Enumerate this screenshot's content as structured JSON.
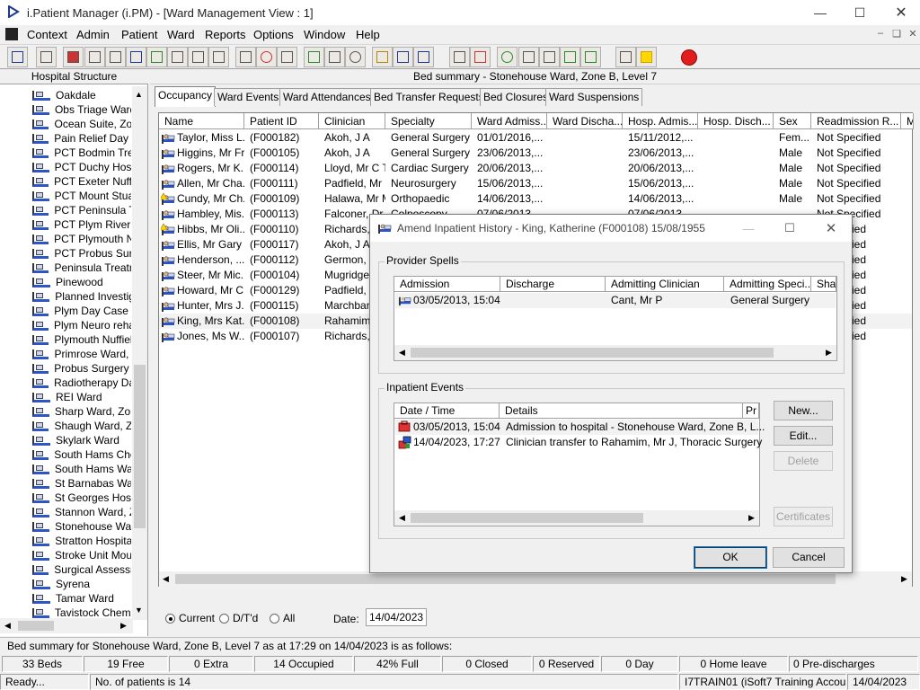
{
  "window": {
    "title": "i.Patient Manager (i.PM) - [Ward Management View : 1]"
  },
  "menu": [
    "Context",
    "Admin",
    "Patient",
    "Ward",
    "Reports",
    "Options",
    "Window",
    "Help"
  ],
  "tree": {
    "header": "Hospital Structure",
    "items": [
      "Oakdale",
      "Obs Triage Ward",
      "Ocean Suite, Zon",
      "Pain Relief Day C",
      "PCT Bodmin Trea",
      "PCT Duchy Hosp",
      "PCT Exeter Nuffie",
      "PCT Mount Stuar",
      "PCT Peninsula Tr",
      "PCT Plym River F",
      "PCT Plymouth Nu",
      "PCT Probus Surg",
      "Peninsula Treatm",
      "Pinewood",
      "Planned Investig",
      "Plym Day Case U",
      "Plym Neuro rehab",
      "Plymouth Nuffield",
      "Primrose Ward, Z",
      "Probus Surgery V",
      "Radiotherapy Day",
      "REI Ward",
      "Sharp Ward, Zon",
      "Shaugh Ward, Zo",
      "Skylark Ward",
      "South Hams Cher",
      "South Hams War",
      "St Barnabas War",
      "St Georges Hosp",
      "Stannon Ward, Z",
      "Stonehouse War",
      "Stratton Hospital",
      "Stroke Unit Mour",
      "Surgical Assessm",
      "Syrena",
      "Tamar Ward",
      "Tavistock Chemc"
    ]
  },
  "bed_summary_header": "Bed summary - Stonehouse Ward, Zone B, Level 7",
  "tabs": [
    "Occupancy",
    "Ward Events",
    "Ward Attendances",
    "Bed Transfer Requests",
    "Bed Closures",
    "Ward Suspensions"
  ],
  "grid": {
    "columns": [
      "Name",
      "Patient ID",
      "Clinician",
      "Specialty",
      "Ward Admiss...",
      "Ward Discha...",
      "Hosp. Admis...",
      "Hosp. Disch...",
      "Sex",
      "Readmission R...",
      "M"
    ],
    "rows": [
      [
        "Taylor, Miss L...",
        "(F000182)",
        "Akoh, J A",
        "General Surgery",
        "01/01/2016,...",
        "",
        "15/11/2012,...",
        "",
        "Fem...",
        "Not Specified"
      ],
      [
        "Higgins, Mr Fr...",
        "(F000105)",
        "Akoh, J A",
        "General Surgery",
        "23/06/2013,...",
        "",
        "23/06/2013,...",
        "",
        "Male",
        "Not Specified"
      ],
      [
        "Rogers, Mr K...",
        "(F000114)",
        "Lloyd, Mr C T",
        "Cardiac Surgery",
        "20/06/2013,...",
        "",
        "20/06/2013,...",
        "",
        "Male",
        "Not Specified"
      ],
      [
        "Allen, Mr Cha...",
        "(F000111)",
        "Padfield, Mr L",
        "Neurosurgery",
        "15/06/2013,...",
        "",
        "15/06/2013,...",
        "",
        "Male",
        "Not Specified"
      ],
      [
        "Cundy, Mr Ch...",
        "(F000109)",
        "Halawa, Mr M",
        "Orthopaedic",
        "14/06/2013,...",
        "",
        "14/06/2013,...",
        "",
        "Male",
        "Not Specified"
      ],
      [
        "Hambley, Mis...",
        "(F000113)",
        "Falconer, Dr A D",
        "Colposcopy",
        "07/06/2013",
        "",
        "07/06/2013",
        "",
        "",
        "Not Specified"
      ],
      [
        "Hibbs, Mr Oli...",
        "(F000110)",
        "Richards, Mr S",
        "",
        "",
        "",
        "",
        "",
        "",
        "ified"
      ],
      [
        "Ellis, Mr Gary",
        "(F000117)",
        "Akoh, J A",
        "",
        "",
        "",
        "",
        "",
        "",
        "ified"
      ],
      [
        "Henderson, ...",
        "(F000112)",
        "Germon, Mr T J",
        "",
        "",
        "",
        "",
        "",
        "",
        "ified"
      ],
      [
        "Steer, Mr Mic...",
        "(F000104)",
        "Mugridge, Surg",
        "",
        "",
        "",
        "",
        "",
        "",
        "ified"
      ],
      [
        "Howard, Mr C...",
        "(F000129)",
        "Padfield, Mr L",
        "",
        "",
        "",
        "",
        "",
        "",
        "ified"
      ],
      [
        "Hunter, Mrs J...",
        "(F000115)",
        "Marchbank, Mr",
        "",
        "",
        "",
        "",
        "",
        "",
        "ified"
      ],
      [
        "King, Mrs Kat...",
        "(F000108)",
        "Rahamim, Mr J",
        "",
        "",
        "",
        "",
        "",
        "",
        "ified"
      ],
      [
        "Jones, Ms W...",
        "(F000107)",
        "Richards, Mr S",
        "",
        "",
        "",
        "",
        "",
        "",
        "ified"
      ]
    ]
  },
  "filters": {
    "current": "Current",
    "dtd": "D/T'd",
    "all": "All",
    "date_label": "Date:",
    "date_value": "14/04/2023"
  },
  "status_line": "Bed summary for Stonehouse Ward, Zone B, Level 7 as at 17:29 on 14/04/2023 is as follows:",
  "stats": [
    "33 Beds",
    "19 Free",
    "0 Extra",
    "14 Occupied",
    "42% Full",
    "0 Closed",
    "0 Reserved",
    "0 Day",
    "0 Home leave",
    "0 Pre-discharges"
  ],
  "statusbar": {
    "ready": "Ready...",
    "patients": "No. of patients is 14",
    "user": "I7TRAIN01 (iSoft7 Training Account)",
    "date": "14/04/2023"
  },
  "dialog": {
    "title": "Amend Inpatient History - King, Katherine (F000108) 15/08/1955",
    "provider_spells": {
      "label": "Provider Spells",
      "columns": [
        "Admission",
        "Discharge",
        "Admitting Clinician",
        "Admitting Speci...",
        "Shar"
      ],
      "rows": [
        [
          "03/05/2013, 15:04",
          "",
          "Cant, Mr P",
          "General Surgery",
          ""
        ]
      ]
    },
    "inpatient_events": {
      "label": "Inpatient Events",
      "columns": [
        "Date / Time",
        "Details",
        "Pr"
      ],
      "rows": [
        [
          "03/05/2013, 15:04",
          "Admission to hospital - Stonehouse Ward, Zone B, L..."
        ],
        [
          "14/04/2023, 17:27",
          "Clinician transfer to Rahamim, Mr J, Thoracic Surgery"
        ]
      ]
    },
    "buttons": {
      "new": "New...",
      "edit": "Edit...",
      "delete": "Delete",
      "certificates": "Certificates",
      "ok": "OK",
      "cancel": "Cancel"
    }
  },
  "colors": {
    "accent": "#0078d7",
    "bed_blue": "#2b55c8",
    "exit_red": "#e01e1e"
  }
}
